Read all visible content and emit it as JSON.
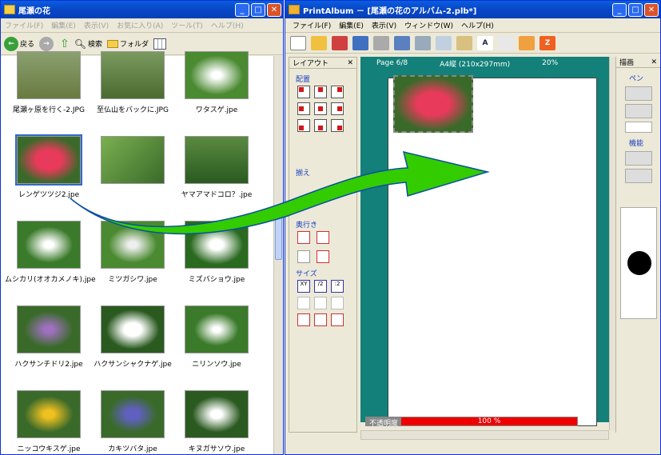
{
  "explorer": {
    "title": "尾瀬の花",
    "menu": [
      "ファイル(F)",
      "編集(E)",
      "表示(V)",
      "お気に入り(A)",
      "ツール(T)",
      "ヘルプ(H)"
    ],
    "toolbar": {
      "back": "戻る",
      "search": "検索",
      "folders": "フォルダ"
    },
    "files": [
      "尾瀬ヶ原を行く-2.JPG",
      "至仏山をバックに.JPG",
      "ワタスゲ.jpe",
      "レンゲツツジ2.jpe",
      "",
      "ヤマアマドコロ？.jpe",
      "ムシカリ(オオカメノキ).jpe",
      "ミツガシワ.jpe",
      "ミズバショウ.jpe",
      "ハクサンチドリ2.jpe",
      "ハクサンシャクナゲ.jpe",
      "ニリンソウ.jpe",
      "ニッコウキスゲ.jpe",
      "カキツバタ.jpe",
      "キヌガサソウ.jpe"
    ]
  },
  "printalbum": {
    "title": "PrintAlbum － [尾瀬の花のアルバム-2.plb*]",
    "menu": [
      "ファイル(F)",
      "編集(E)",
      "表示(V)",
      "ウィンドウ(W)",
      "ヘルプ(H)"
    ],
    "layout_panel": {
      "header": "レイアウト",
      "sections": [
        "配置",
        "揃え",
        "奥行き",
        "サイズ"
      ]
    },
    "canvas": {
      "page": "Page 6/8",
      "paper": "A4縦 (210x297mm)",
      "zoom": "20%"
    },
    "draw_panel": {
      "header": "描画",
      "sections": [
        "ペン",
        "機能"
      ]
    },
    "opacity": {
      "label": "不透明度",
      "value": "100 %"
    }
  },
  "colors": {
    "xp_blue": "#0a5ede",
    "teal": "#138079",
    "arrow": "#33cc00"
  }
}
